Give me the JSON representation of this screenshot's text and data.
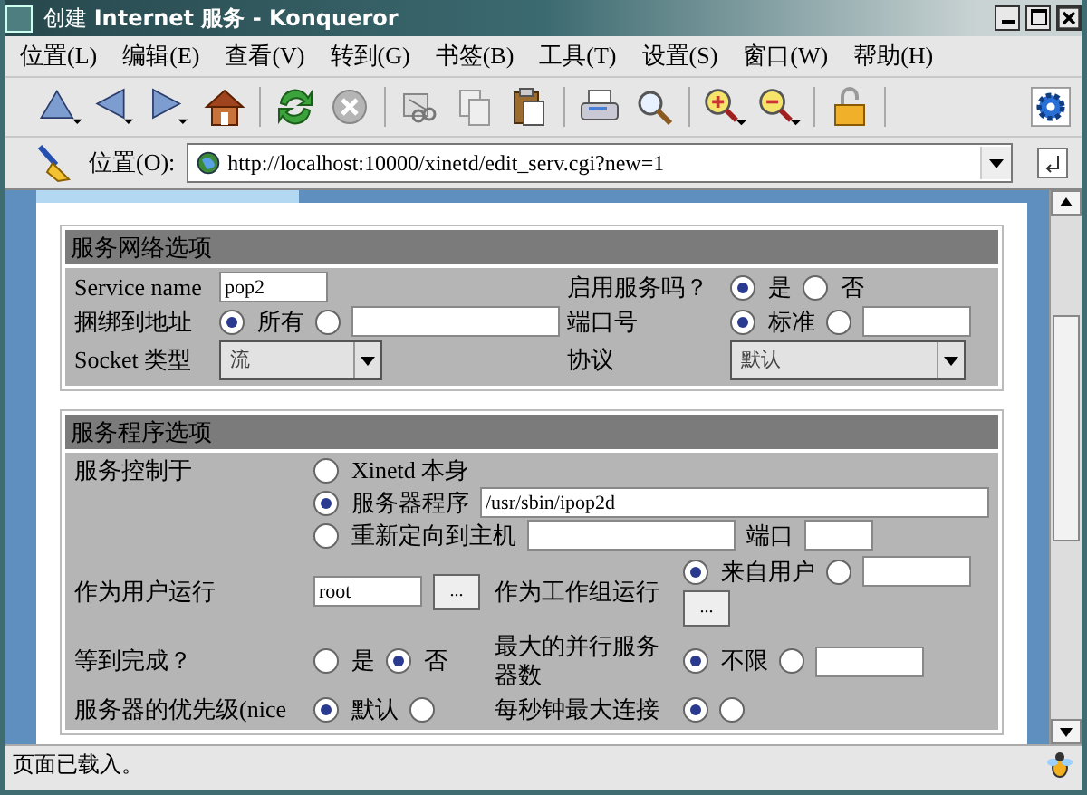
{
  "window": {
    "title": "创建 **Internet 服务 - Konqueror**"
  },
  "menu": [
    "位置(L)",
    "编辑(E)",
    "查看(V)",
    "转到(G)",
    "书签(B)",
    "工具(T)",
    "设置(S)",
    "窗口(W)",
    "帮助(H)"
  ],
  "location": {
    "label": "位置(O):",
    "url": "http://localhost:10000/xinetd/edit_serv.cgi?new=1"
  },
  "sections": [
    {
      "title": "服务网络选项",
      "rows": [
        {
          "cells": [
            {
              "kind": "label",
              "text": "Service  name"
            },
            {
              "kind": "controls",
              "items": [
                {
                  "kind": "field",
                  "value": "pop2"
                }
              ]
            },
            {
              "kind": "label",
              "text": "启用服务吗？"
            },
            {
              "kind": "controls",
              "items": [
                {
                  "kind": "radio",
                  "label": "是",
                  "selected": true
                },
                {
                  "kind": "radio",
                  "label": "否",
                  "selected": false
                }
              ]
            }
          ]
        },
        {
          "cells": [
            {
              "kind": "label",
              "text": "捆绑到地址"
            },
            {
              "kind": "controls",
              "items": [
                {
                  "kind": "radio",
                  "label": "所有",
                  "selected": true
                },
                {
                  "kind": "radio",
                  "selected": false
                },
                {
                  "kind": "long-field",
                  "value": ""
                }
              ]
            },
            {
              "kind": "label",
              "text": "端口号"
            },
            {
              "kind": "controls",
              "items": [
                {
                  "kind": "radio",
                  "label": "标准",
                  "selected": true
                },
                {
                  "kind": "radio",
                  "selected": false
                },
                {
                  "kind": "field",
                  "value": ""
                }
              ]
            }
          ]
        },
        {
          "cells": [
            {
              "kind": "label",
              "text": "Socket  类型"
            },
            {
              "kind": "controls",
              "items": [
                {
                  "kind": "select",
                  "value": "流"
                }
              ]
            },
            {
              "kind": "label",
              "text": "协议"
            },
            {
              "kind": "controls",
              "items": [
                {
                  "kind": "select",
                  "value": "默认"
                }
              ]
            }
          ]
        }
      ]
    },
    {
      "title": "服务程序选项",
      "rows": [
        {
          "cells": [
            {
              "kind": "label",
              "text": "服务控制于"
            },
            {
              "kind": "wide-controls",
              "lines": [
                {
                  "items": [
                    {
                      "kind": "radio",
                      "label": "Xinetd  本身",
                      "selected": false
                    }
                  ]
                },
                {
                  "items": [
                    {
                      "kind": "radio",
                      "label": "服务器程序",
                      "selected": true
                    },
                    {
                      "kind": "long-field",
                      "value": "/usr/sbin/ipop2d"
                    }
                  ]
                },
                {
                  "items": [
                    {
                      "kind": "radio",
                      "label": "重新定向到主机",
                      "selected": false
                    },
                    {
                      "kind": "mid-field",
                      "value": ""
                    },
                    {
                      "kind": "text",
                      "text": "端口"
                    },
                    {
                      "kind": "small-field",
                      "value": ""
                    }
                  ]
                }
              ]
            }
          ]
        },
        {
          "cells": [
            {
              "kind": "label",
              "text": "作为用户运行"
            },
            {
              "kind": "controls",
              "items": [
                {
                  "kind": "field",
                  "value": "root"
                },
                {
                  "kind": "button",
                  "label": "..."
                }
              ]
            },
            {
              "kind": "label",
              "text": "作为工作组运行"
            },
            {
              "kind": "controls",
              "items": [
                {
                  "kind": "radio",
                  "label": "来自用户",
                  "selected": true
                },
                {
                  "kind": "radio",
                  "selected": false
                },
                {
                  "kind": "field",
                  "value": ""
                },
                {
                  "kind": "button",
                  "label": "..."
                }
              ]
            }
          ]
        },
        {
          "cells": [
            {
              "kind": "label",
              "text": "等到完成？"
            },
            {
              "kind": "controls",
              "items": [
                {
                  "kind": "radio",
                  "label": "是",
                  "selected": false
                },
                {
                  "kind": "radio",
                  "label": "否",
                  "selected": true
                }
              ]
            },
            {
              "kind": "label",
              "text": "最大的并行服务器数"
            },
            {
              "kind": "controls",
              "items": [
                {
                  "kind": "radio",
                  "label": "不限",
                  "selected": true
                },
                {
                  "kind": "radio",
                  "selected": false
                },
                {
                  "kind": "field",
                  "value": ""
                }
              ]
            }
          ]
        },
        {
          "cells": [
            {
              "kind": "label",
              "text": "服务器的优先级(nice"
            },
            {
              "kind": "controls",
              "items": [
                {
                  "kind": "radio",
                  "label": "默认",
                  "selected": true
                },
                {
                  "kind": "radio",
                  "selected": false
                }
              ]
            },
            {
              "kind": "label",
              "text": "每秒钟最大连接"
            },
            {
              "kind": "controls",
              "items": [
                {
                  "kind": "radio",
                  "selected": true
                },
                {
                  "kind": "radio",
                  "selected": false
                }
              ]
            }
          ]
        }
      ]
    }
  ],
  "status_bar": "页面已载入。"
}
